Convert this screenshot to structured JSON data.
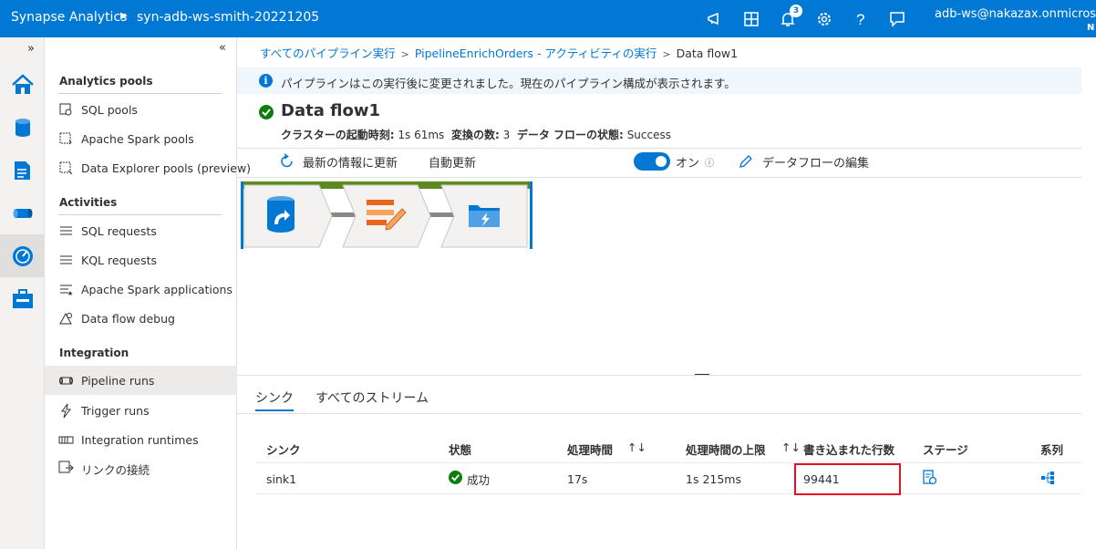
{
  "topbar": {
    "app_name": "Synapse Analytics",
    "workspace": "syn-adb-ws-smith-20221205",
    "notification_count": "3",
    "user_line1": "adb-ws@nakazax.onmicroso",
    "user_line2": "N"
  },
  "sidebar": {
    "sections": [
      {
        "title": "Analytics pools",
        "items": [
          "SQL pools",
          "Apache Spark pools",
          "Data Explorer pools (preview)"
        ]
      },
      {
        "title": "Activities",
        "items": [
          "SQL requests",
          "KQL requests",
          "Apache Spark applications",
          "Data flow debug"
        ]
      },
      {
        "title": "Integration",
        "items": [
          "Pipeline runs",
          "Trigger runs",
          "Integration runtimes",
          "リンクの接続"
        ]
      }
    ],
    "selected": "Pipeline runs"
  },
  "breadcrumb": {
    "item1": "すべてのパイプライン実行",
    "item2": "PipelineEnrichOrders - アクティビティの実行",
    "item3": "Data flow1"
  },
  "info_banner": "パイプラインはこの実行後に変更されました。現在のパイプライン構成が表示されます。",
  "header": {
    "title": "Data flow1",
    "startup_label": "クラスターの起動時刻:",
    "startup_value": "1s 61ms",
    "transforms_label": "変換の数:",
    "transforms_value": "3",
    "status_label": "データ フローの状態:",
    "status_value": "Success"
  },
  "toolbar": {
    "refresh": "最新の情報に更新",
    "auto_refresh": "自動更新",
    "toggle_state": "オン",
    "edit": "データフローの編集"
  },
  "tabs": [
    "シンク",
    "すべてのストリーム"
  ],
  "table": {
    "headers": [
      "シンク",
      "状態",
      "処理時間",
      "処理時間の上限",
      "書き込まれた行数",
      "ステージ",
      "系列"
    ],
    "rows": [
      {
        "sink": "sink1",
        "status": "成功",
        "time": "17s",
        "max_time": "1s 215ms",
        "rows_written": "99441"
      }
    ]
  },
  "colors": {
    "accent": "#0078d4",
    "success": "#107c10",
    "highlight": "#e81123",
    "flow_border": "#5c8a1e"
  }
}
